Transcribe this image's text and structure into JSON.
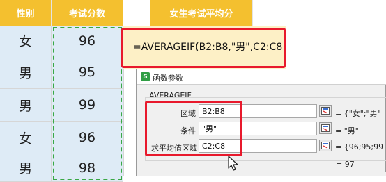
{
  "sheet": {
    "headers": [
      "性别",
      "考试分数"
    ],
    "title_cell": "女生考试平均分",
    "formula": "=AVERAGEIF(B2:B8,\"男\",C2:C8",
    "rows": [
      {
        "gender": "女",
        "score": "96"
      },
      {
        "gender": "男",
        "score": "95"
      },
      {
        "gender": "男",
        "score": "99"
      },
      {
        "gender": "女",
        "score": "96"
      },
      {
        "gender": "男",
        "score": "98"
      }
    ]
  },
  "dialog": {
    "app_icon": "S",
    "title": "函数参数",
    "function_name": "AVERAGEIF",
    "args": [
      {
        "label": "区域",
        "value": "B2:B8",
        "result": "{\"女\";\"男\"",
        "sep": "="
      },
      {
        "label": "条件",
        "value": "\"男\"",
        "result": "\"男\"",
        "sep": "="
      },
      {
        "label": "求平均值区域",
        "value": "C2:C8",
        "result": "{96;95;99",
        "sep": "="
      }
    ],
    "total": "= 97"
  },
  "colors": {
    "header": "#f4c02f",
    "highlight": "#e8192c",
    "sel": "#deebf6"
  }
}
